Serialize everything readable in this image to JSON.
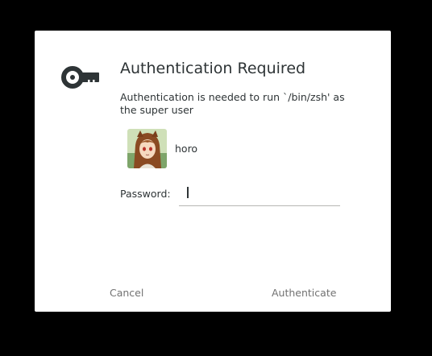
{
  "dialog": {
    "title": "Authentication Required",
    "message": "Authentication is needed to run `/bin/zsh' as the super user",
    "icon": "key-icon",
    "user": {
      "name": "horo",
      "avatar": "anime-avatar"
    },
    "password": {
      "label": "Password:",
      "value": ""
    },
    "buttons": {
      "cancel": "Cancel",
      "authenticate": "Authenticate"
    },
    "colors": {
      "background": "#000000",
      "dialog": "#ffffff",
      "text": "#2e3436",
      "button_text": "#727272"
    }
  }
}
